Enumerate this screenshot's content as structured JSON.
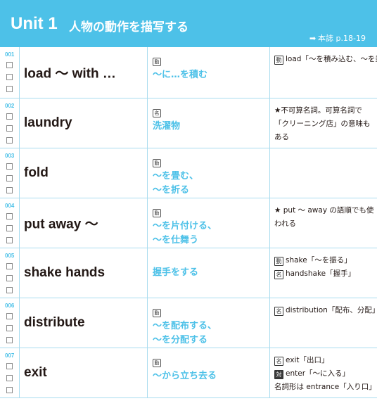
{
  "header": {
    "unit": "Unit 1",
    "subtitle": "人物の動作を描写する",
    "ref_arrow": "➡",
    "ref": "本誌 p.18-19"
  },
  "colors": {
    "accent": "#4dc1e8",
    "text": "#231815",
    "grid": "#a9dcef"
  },
  "entries": [
    {
      "num": "001",
      "word": "load ～ with …",
      "pos": "動",
      "meaning": "～に…を積む",
      "notes": [
        {
          "badge": "動",
          "text": "load「～を積み込む、～を乗せる」"
        }
      ]
    },
    {
      "num": "002",
      "word": "laundry",
      "pos": "名",
      "meaning": "洗濯物",
      "notes": [
        {
          "badge": "",
          "text": "★不可算名詞。可算名詞で「クリーニング店」の意味もある"
        }
      ]
    },
    {
      "num": "003",
      "word": "fold",
      "pos": "動",
      "meaning": "～を畳む、\n～を折る",
      "notes": []
    },
    {
      "num": "004",
      "word": "put away ～",
      "pos": "動",
      "meaning": "～を片付ける、\n～を仕舞う",
      "notes": [
        {
          "badge": "",
          "text": "★ put ～ away の語順でも使われる"
        }
      ]
    },
    {
      "num": "005",
      "word": "shake hands",
      "pos": "",
      "meaning": "握手をする",
      "notes": [
        {
          "badge": "動",
          "text": "shake「～を振る」"
        },
        {
          "badge": "名",
          "text": "handshake「握手」"
        }
      ]
    },
    {
      "num": "006",
      "word": "distribute",
      "pos": "動",
      "meaning": "～を配布する、\n～を分配する",
      "notes": [
        {
          "badge": "名",
          "text": "distribution「配布、分配」"
        }
      ]
    },
    {
      "num": "007",
      "word": "exit",
      "pos": "動",
      "meaning": "～から立ち去る",
      "notes": [
        {
          "badge": "名",
          "text": "exit「出口」"
        },
        {
          "badge": "対",
          "badge_style": "dark",
          "text": "enter「～に入る」"
        },
        {
          "badge": "",
          "text": "名詞形は entrance「入り口」"
        }
      ]
    }
  ]
}
